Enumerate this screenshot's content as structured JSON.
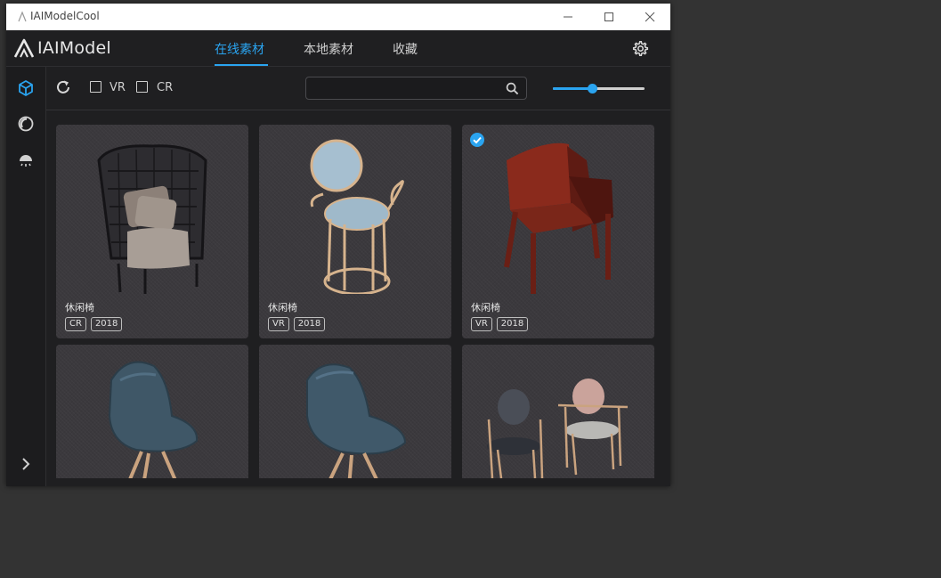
{
  "window": {
    "title": "IAIModelCool"
  },
  "header": {
    "logo_text": "IAIModel",
    "tabs": [
      {
        "label": "在线素材",
        "active": true
      },
      {
        "label": "本地素材",
        "active": false
      },
      {
        "label": "收藏",
        "active": false
      }
    ]
  },
  "toolbar": {
    "filters": [
      {
        "label": "VR",
        "checked": false
      },
      {
        "label": "CR",
        "checked": false
      }
    ],
    "search": {
      "value": "",
      "placeholder": ""
    },
    "zoom_slider": {
      "value": 0.43
    }
  },
  "sidebar": {
    "items": [
      {
        "icon": "cube-icon",
        "active": true
      },
      {
        "icon": "material-sphere-icon",
        "active": false
      },
      {
        "icon": "lamp-icon",
        "active": false
      }
    ],
    "expand_icon": "chevron-right-icon"
  },
  "cards": [
    {
      "name": "休闲椅",
      "badges": [
        "CR",
        "2018"
      ],
      "selected": false
    },
    {
      "name": "休闲椅",
      "badges": [
        "VR",
        "2018"
      ],
      "selected": false
    },
    {
      "name": "休闲椅",
      "badges": [
        "VR",
        "2018"
      ],
      "selected": true
    },
    {
      "name": "",
      "badges": [],
      "selected": false
    },
    {
      "name": "",
      "badges": [],
      "selected": false
    },
    {
      "name": "",
      "badges": [],
      "selected": false
    }
  ],
  "colors": {
    "accent": "#2aa4f0",
    "background": "#1f1f21",
    "card": "#3b393d"
  }
}
